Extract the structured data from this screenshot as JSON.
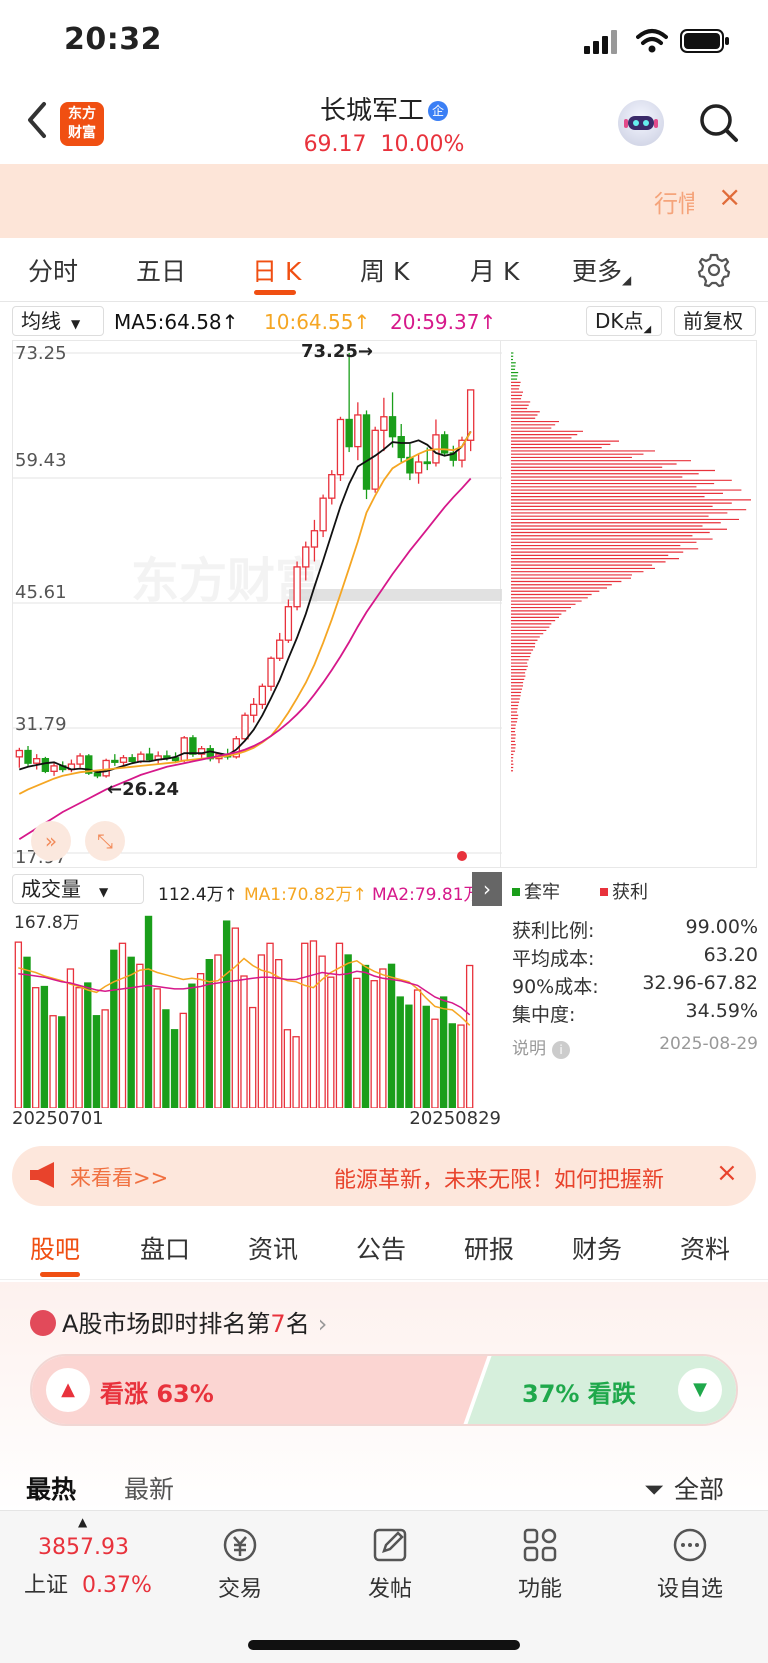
{
  "status": {
    "time": "20:32"
  },
  "header": {
    "logo_line1": "东方",
    "logo_line2": "财富",
    "stock_name": "长城军工",
    "badge": "企",
    "price": "69.17",
    "change_pct": "10.00%"
  },
  "banner": {
    "text": "行情",
    "close": "×"
  },
  "period_tabs": [
    "分时",
    "五日",
    "日 K",
    "周 K",
    "月 K",
    "更多"
  ],
  "ma_bar": {
    "selector": "均线",
    "ma5": "MA5:64.58↑",
    "ma10": "10:64.55↑",
    "ma20": "20:59.37↑",
    "dk": "DK点",
    "adjust": "前复权"
  },
  "price_axis": [
    "73.25",
    "59.43",
    "45.61",
    "31.79",
    "17.97"
  ],
  "annotations": {
    "high": "73.25→",
    "low": "←26.24"
  },
  "watermark": "东方财富",
  "volume_bar": {
    "selector": "成交量",
    "vol": "112.4万↑",
    "ma1": "MA1:70.82万↑",
    "ma2": "MA2:79.81万"
  },
  "volume_axis_max": "167.8万",
  "dates": {
    "start": "20250701",
    "end": "20250829"
  },
  "legend": {
    "trapped": "套牢",
    "profit": "获利"
  },
  "stats": [
    {
      "label": "获利比例:",
      "value": "99.00%"
    },
    {
      "label": "平均成本:",
      "value": "63.20"
    },
    {
      "label": "90%成本:",
      "value": "32.96-67.82"
    },
    {
      "label": "集中度:",
      "value": "34.59%"
    },
    {
      "label": "说明",
      "value": "2025-08-29"
    }
  ],
  "ad": {
    "left": "来看看>>",
    "text": "能源革新，未来无限！如何把握新",
    "close": "×"
  },
  "section_tabs": [
    "股吧",
    "盘口",
    "资讯",
    "公告",
    "研报",
    "财务",
    "资料"
  ],
  "rank": {
    "prefix": "A股市场即时排名第",
    "number": "7",
    "suffix": "名"
  },
  "vote": {
    "up": "看涨 63%",
    "down": "37% 看跌",
    "up_pct": 63
  },
  "feed": {
    "hot": "最热",
    "new": "最新",
    "filter": "全部"
  },
  "bottom_nav": {
    "index_value": "3857.93",
    "index_name": "上证",
    "index_change": "0.37%",
    "items": [
      "交易",
      "发帖",
      "功能",
      "设自选"
    ]
  },
  "colors": {
    "up": "#e8323c",
    "down": "#1a9e1a",
    "accent": "#f04f12",
    "ma5": "#111111",
    "ma10": "#f5a623",
    "ma20": "#d6188a"
  },
  "chart_data": {
    "type": "candlestick",
    "period": "daily",
    "ylim": [
      17.97,
      73.25
    ],
    "y_ticks": [
      73.25,
      59.43,
      45.61,
      31.79,
      17.97
    ],
    "candles": [
      [
        28.6,
        29.6,
        27.4,
        29.3
      ],
      [
        29.3,
        29.8,
        27.6,
        27.9
      ],
      [
        27.9,
        28.9,
        27.2,
        28.4
      ],
      [
        28.4,
        28.6,
        26.8,
        27.0
      ],
      [
        27.0,
        27.9,
        26.5,
        27.6
      ],
      [
        27.6,
        28.1,
        26.9,
        27.2
      ],
      [
        27.2,
        28.3,
        26.9,
        27.8
      ],
      [
        27.8,
        29.0,
        27.4,
        28.7
      ],
      [
        28.7,
        28.9,
        26.6,
        26.8
      ],
      [
        26.8,
        27.1,
        26.24,
        26.5
      ],
      [
        26.5,
        28.4,
        26.3,
        28.2
      ],
      [
        28.2,
        28.9,
        27.6,
        28.0
      ],
      [
        28.0,
        28.8,
        27.6,
        28.5
      ],
      [
        28.5,
        28.9,
        27.8,
        28.1
      ],
      [
        28.1,
        29.2,
        27.9,
        28.9
      ],
      [
        28.9,
        29.6,
        28.1,
        28.3
      ],
      [
        28.3,
        29.2,
        27.8,
        28.7
      ],
      [
        28.7,
        29.3,
        28.2,
        28.5
      ],
      [
        28.5,
        29.1,
        27.9,
        28.2
      ],
      [
        28.2,
        30.9,
        28.0,
        30.7
      ],
      [
        30.7,
        31.0,
        28.6,
        28.9
      ],
      [
        28.9,
        29.8,
        28.5,
        29.5
      ],
      [
        29.5,
        29.9,
        28.1,
        28.4
      ],
      [
        28.4,
        29.1,
        27.9,
        28.9
      ],
      [
        28.9,
        29.5,
        28.3,
        28.6
      ],
      [
        28.6,
        30.9,
        28.4,
        30.6
      ],
      [
        30.6,
        33.5,
        30.4,
        33.2
      ],
      [
        33.2,
        35.1,
        32.4,
        34.4
      ],
      [
        34.4,
        36.7,
        33.9,
        36.4
      ],
      [
        36.4,
        39.7,
        35.9,
        39.5
      ],
      [
        39.5,
        42.3,
        39.2,
        41.5
      ],
      [
        41.5,
        46.0,
        41.2,
        45.2
      ],
      [
        45.2,
        50.2,
        44.8,
        49.6
      ],
      [
        49.6,
        52.4,
        48.1,
        51.8
      ],
      [
        51.8,
        54.8,
        50.2,
        53.6
      ],
      [
        53.6,
        57.6,
        52.9,
        57.2
      ],
      [
        57.2,
        60.3,
        56.5,
        59.8
      ],
      [
        59.8,
        66.2,
        59.1,
        65.9
      ],
      [
        65.9,
        73.25,
        62.3,
        62.9
      ],
      [
        62.9,
        67.8,
        61.4,
        66.4
      ],
      [
        66.4,
        66.9,
        57.1,
        58.2
      ],
      [
        58.2,
        65.1,
        57.8,
        64.7
      ],
      [
        64.7,
        68.3,
        62.4,
        66.2
      ],
      [
        66.2,
        68.9,
        62.8,
        64.0
      ],
      [
        64.0,
        65.4,
        61.2,
        61.7
      ],
      [
        61.7,
        63.2,
        59.2,
        60.0
      ],
      [
        60.0,
        62.1,
        58.8,
        61.2
      ],
      [
        61.2,
        62.8,
        60.3,
        61.1
      ],
      [
        61.1,
        65.9,
        60.7,
        64.2
      ],
      [
        64.2,
        64.6,
        61.8,
        62.2
      ],
      [
        62.2,
        63.0,
        60.7,
        61.4
      ],
      [
        61.4,
        64.0,
        60.6,
        63.6
      ],
      [
        63.6,
        67.1,
        62.4,
        69.17
      ]
    ],
    "volume_ylim": [
      0,
      167.8
    ],
    "volume": [
      142,
      129,
      103,
      104,
      79,
      78,
      119,
      103,
      107,
      79,
      84,
      135,
      141,
      129,
      123,
      164,
      102,
      84,
      67,
      81,
      106,
      115,
      127,
      131,
      160,
      154,
      113,
      86,
      131,
      141,
      127,
      67,
      61,
      141,
      143,
      130,
      112,
      141,
      131,
      111,
      122,
      109,
      119,
      123,
      95,
      88,
      101,
      87,
      76,
      95,
      72,
      71,
      122
    ],
    "ma5": [
      27.2,
      27.5,
      27.7,
      27.9,
      28.0,
      27.6,
      27.2,
      27.3,
      27.2,
      26.9,
      27.0,
      27.3,
      27.6,
      27.9,
      28.1,
      28.1,
      28.3,
      28.4,
      28.6,
      29.0,
      29.0,
      29.0,
      29.2,
      29.0,
      28.8,
      29.4,
      30.4,
      31.6,
      33.2,
      35.1,
      37.1,
      39.5,
      41.8,
      44.4,
      47.4,
      50.3,
      53.3,
      56.3,
      58.8,
      60.7,
      61.3,
      61.9,
      62.6,
      63.4,
      63.3,
      63.3,
      63.6,
      63.1,
      62.2,
      61.9,
      62.1,
      62.9,
      64.58
    ],
    "ma10": [
      24.5,
      25.0,
      25.4,
      25.8,
      26.2,
      26.5,
      26.7,
      26.9,
      27.0,
      27.1,
      27.2,
      27.3,
      27.4,
      27.5,
      27.6,
      27.7,
      27.8,
      27.9,
      28.0,
      28.2,
      28.3,
      28.4,
      28.5,
      28.6,
      28.7,
      28.9,
      29.2,
      29.6,
      30.2,
      30.9,
      32.1,
      33.5,
      35.1,
      36.8,
      38.8,
      41.2,
      43.8,
      46.6,
      49.5,
      52.4,
      55.6,
      57.5,
      59.2,
      60.5,
      61.1,
      61.6,
      62.1,
      62.5,
      62.6,
      62.6,
      62.5,
      62.9,
      64.55
    ],
    "ma20": [
      19.5,
      20.1,
      20.7,
      21.3,
      21.9,
      22.5,
      23.0,
      23.5,
      24.0,
      24.5,
      25.0,
      25.4,
      25.8,
      26.2,
      26.6,
      26.9,
      27.2,
      27.5,
      27.7,
      27.9,
      28.1,
      28.3,
      28.5,
      28.7,
      28.9,
      29.1,
      29.4,
      29.8,
      30.3,
      30.9,
      31.6,
      32.4,
      33.3,
      34.3,
      35.5,
      36.8,
      38.2,
      39.7,
      41.3,
      43.0,
      44.6,
      46.0,
      47.4,
      48.8,
      50.1,
      51.4,
      52.6,
      53.8,
      55.0,
      56.2,
      57.3,
      58.3,
      59.37
    ],
    "vol_ma1": [
      120,
      118,
      116,
      113,
      111,
      109,
      106,
      104,
      101,
      99,
      104,
      108,
      111,
      114,
      118,
      119,
      116,
      114,
      112,
      110,
      111,
      110,
      108,
      109,
      115,
      121,
      128,
      122,
      118,
      116,
      112,
      109,
      108,
      105,
      103,
      110,
      116,
      120,
      124,
      126,
      121,
      117,
      114,
      112,
      110,
      108,
      102,
      94,
      87,
      85,
      84,
      78,
      70.82
    ],
    "vol_ma2": [
      115,
      114,
      113,
      112,
      110,
      108,
      107,
      105,
      103,
      101,
      100,
      101,
      102,
      103,
      104,
      105,
      104,
      103,
      102,
      102,
      103,
      104,
      106,
      107,
      108,
      109,
      110,
      111,
      112,
      112,
      111,
      110,
      110,
      112,
      114,
      116,
      115,
      114,
      115,
      117,
      116,
      113,
      111,
      110,
      109,
      107,
      105,
      100,
      95,
      92,
      90,
      86,
      79.81
    ],
    "chip_distribution": [
      1,
      2,
      3,
      4,
      5,
      8,
      12,
      20,
      30,
      45,
      60,
      75,
      85,
      92,
      96,
      100,
      98,
      95,
      90,
      84,
      78,
      70,
      60,
      50,
      40,
      32,
      25,
      20,
      16,
      12,
      10,
      8,
      7,
      6,
      5,
      4,
      3,
      3,
      2,
      2,
      2,
      1,
      1,
      0,
      0,
      0,
      0,
      0
    ]
  }
}
